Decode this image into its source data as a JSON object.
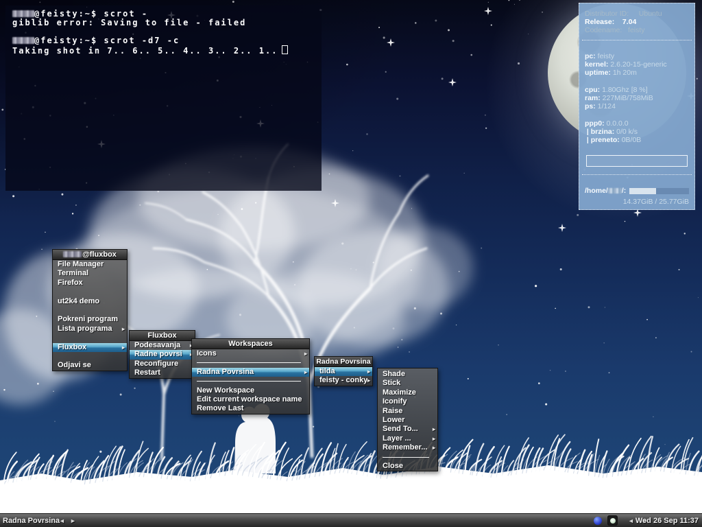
{
  "colors": {
    "menu_highlight_top": "#9fd6e6",
    "menu_highlight_bottom": "#2a72a0",
    "conky_bg": "#83a7ce",
    "sky_top": "#060918",
    "sky_horizon": "#1e4878",
    "toolbar_bg": "#4b4b4b"
  },
  "icons": {
    "submenu_arrow": "▸",
    "prev_arrow": "◄",
    "next_arrow": "►",
    "tray": [
      "blue-orb-icon",
      "camera-icon"
    ]
  },
  "terminal": {
    "lines": [
      {
        "censored": true,
        "text": "@feisty:~$ scrot -"
      },
      {
        "censored": false,
        "text": "giblib error: Saving to file - failed"
      },
      {
        "censored": false,
        "text": ""
      },
      {
        "censored": true,
        "text": "@feisty:~$ scrot -d7 -c"
      },
      {
        "censored": false,
        "text": "Taking shot in 7.. 6.. 5.. 4.. 3.. 2.. 1..",
        "cursor": true
      }
    ]
  },
  "conky": {
    "os_rows": [
      {
        "text": "Distributor ID:     Ubuntu",
        "bright": false
      },
      {
        "text": "Release:    7.04",
        "bright": true
      },
      {
        "text": "Codename:   feisty",
        "bright": false
      }
    ],
    "groups": [
      {
        "rows": [
          {
            "label": "pc:",
            "value": " feisty"
          },
          {
            "label": "kernel:",
            "value": " 2.6.20-15-generic"
          },
          {
            "label": "uptime:",
            "value": " 1h 20m"
          }
        ]
      },
      {
        "rows": [
          {
            "label": "cpu:",
            "value": " 1.80Ghz [8 %]"
          },
          {
            "label": "ram:",
            "value": " 227MiB/758MiB"
          },
          {
            "label": "ps:",
            "value": " 1/124"
          }
        ]
      },
      {
        "rows": [
          {
            "label": "ppp0:",
            "value": " 0.0.0.0"
          },
          {
            "label": " | brzina:",
            "value": " 0/0 k/s"
          },
          {
            "label": " | preneto:",
            "value": " 0B/0B"
          }
        ]
      }
    ],
    "net_bar_percent": 0,
    "disk": {
      "prefix": "/home/",
      "censored": true,
      "suffix": "/:",
      "bar_percent": 45,
      "usage": "14.37GiB / 25.77GiB"
    }
  },
  "menus": [
    {
      "title": {
        "censored": true,
        "text": "@fluxbox"
      },
      "items": [
        {
          "label": "File Manager"
        },
        {
          "label": "Terminal"
        },
        {
          "label": "Firefox"
        },
        {
          "type": "gap"
        },
        {
          "label": "ut2k4 demo"
        },
        {
          "type": "gap"
        },
        {
          "label": "Pokreni program"
        },
        {
          "label": "Lista programa",
          "submenu": true
        },
        {
          "type": "gap"
        },
        {
          "label": "Fluxbox",
          "submenu": true,
          "highlighted": true
        },
        {
          "type": "gap"
        },
        {
          "label": "Odjavi se"
        }
      ]
    },
    {
      "title": {
        "censored": false,
        "text": "Fluxbox"
      },
      "items": [
        {
          "label": "Podesavanja",
          "submenu": true
        },
        {
          "label": "Radne povrsi",
          "submenu": true,
          "highlighted": true
        },
        {
          "label": "Reconfigure"
        },
        {
          "label": "Restart"
        }
      ]
    },
    {
      "title": {
        "censored": false,
        "text": "Workspaces"
      },
      "items": [
        {
          "label": "Icons",
          "submenu": true
        },
        {
          "type": "separator"
        },
        {
          "label": "Radna Povrsina",
          "submenu": true,
          "highlighted": true
        },
        {
          "type": "separator"
        },
        {
          "label": "New Workspace"
        },
        {
          "label": "Edit current workspace name"
        },
        {
          "label": "Remove Last"
        }
      ]
    },
    {
      "title": {
        "censored": false,
        "text": "Radna Povrsina"
      },
      "items": [
        {
          "label": "tilda",
          "submenu": true,
          "highlighted": true
        },
        {
          "label": "feisty - conky",
          "submenu": true
        }
      ]
    },
    {
      "title": null,
      "items": [
        {
          "label": "Shade"
        },
        {
          "label": "Stick"
        },
        {
          "label": "Maximize"
        },
        {
          "label": "Iconify"
        },
        {
          "label": "Raise"
        },
        {
          "label": "Lower"
        },
        {
          "label": "Send To...",
          "submenu": true
        },
        {
          "label": "Layer ...",
          "submenu": true
        },
        {
          "label": "Remember...",
          "submenu": true
        },
        {
          "type": "separator"
        },
        {
          "label": "Close"
        }
      ]
    }
  ],
  "toolbar": {
    "workspace": "Radna Povrsina",
    "clock": "Wed 26 Sep 11:37"
  }
}
